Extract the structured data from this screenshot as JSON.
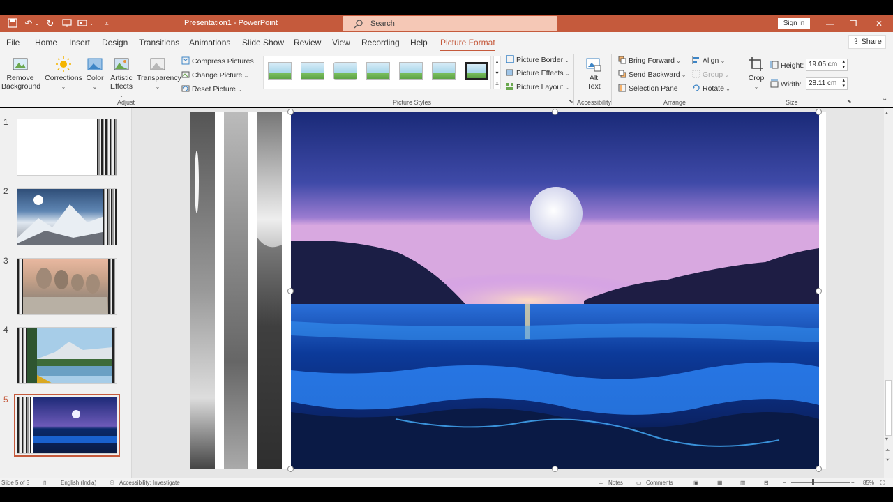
{
  "titlebar": {
    "title": "Presentation1 - PowerPoint",
    "search_placeholder": "Search",
    "sign_in": "Sign in"
  },
  "tabs": [
    "File",
    "Home",
    "Insert",
    "Design",
    "Transitions",
    "Animations",
    "Slide Show",
    "Review",
    "View",
    "Recording",
    "Help",
    "Picture Format"
  ],
  "active_tab": "Picture Format",
  "share_label": "Share",
  "ribbon": {
    "adjust": {
      "remove_background_1": "Remove",
      "remove_background_2": "Background",
      "corrections": "Corrections",
      "color": "Color",
      "artistic_1": "Artistic",
      "artistic_2": "Effects",
      "transparency": "Transparency",
      "compress": "Compress Pictures",
      "change": "Change Picture",
      "reset": "Reset Picture",
      "label": "Adjust"
    },
    "picture_styles": {
      "border": "Picture Border",
      "effects": "Picture Effects",
      "layout": "Picture Layout",
      "label": "Picture Styles"
    },
    "accessibility": {
      "alt_1": "Alt",
      "alt_2": "Text",
      "label": "Accessibility"
    },
    "arrange": {
      "bring_forward": "Bring Forward",
      "send_backward": "Send Backward",
      "selection_pane": "Selection Pane",
      "align": "Align",
      "group": "Group",
      "rotate": "Rotate",
      "label": "Arrange"
    },
    "size": {
      "crop": "Crop",
      "height_label": "Height:",
      "height_value": "19.05 cm",
      "width_label": "Width:",
      "width_value": "28.11 cm",
      "label": "Size"
    }
  },
  "slides": [
    {
      "number": "1"
    },
    {
      "number": "2"
    },
    {
      "number": "3"
    },
    {
      "number": "4"
    },
    {
      "number": "5"
    }
  ],
  "status": {
    "slide": "Slide 5 of 5",
    "language": "English (India)",
    "accessibility": "Accessibility: Investigate",
    "notes": "Notes",
    "comments": "Comments",
    "zoom": "85%"
  },
  "colors": {
    "accent": "#c55a3c",
    "ribbon_bg": "#f3f3f3"
  }
}
